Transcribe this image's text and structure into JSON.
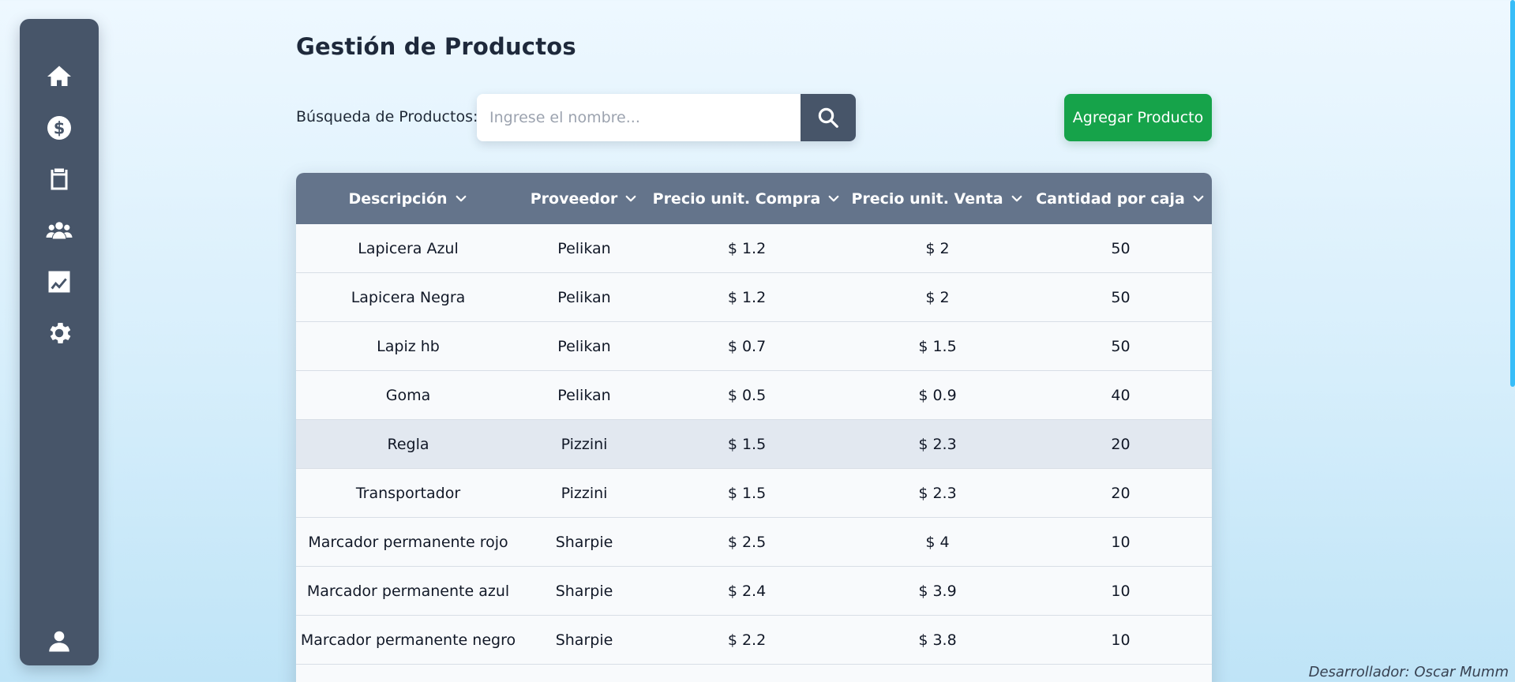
{
  "sidebar": {
    "items": [
      {
        "icon": "home-icon"
      },
      {
        "icon": "dollar-icon"
      },
      {
        "icon": "clipboard-icon"
      },
      {
        "icon": "users-icon"
      },
      {
        "icon": "chart-icon"
      },
      {
        "icon": "gear-icon"
      }
    ],
    "bottom_icon": "user-icon"
  },
  "page": {
    "title": "Gestión de Productos"
  },
  "search": {
    "label": "Búsqueda de Productos:",
    "placeholder": "Ingrese el nombre...",
    "value": ""
  },
  "actions": {
    "add_label": "Agregar Producto"
  },
  "table": {
    "headers": [
      "Descripción",
      "Proveedor",
      "Precio unit. Compra",
      "Precio unit. Venta",
      "Cantidad por caja"
    ],
    "rows": [
      [
        "Lapicera Azul",
        "Pelikan",
        "$ 1.2",
        "$ 2",
        "50"
      ],
      [
        "Lapicera Negra",
        "Pelikan",
        "$ 1.2",
        "$ 2",
        "50"
      ],
      [
        "Lapiz hb",
        "Pelikan",
        "$ 0.7",
        "$ 1.5",
        "50"
      ],
      [
        "Goma",
        "Pelikan",
        "$ 0.5",
        "$ 0.9",
        "40"
      ],
      [
        "Regla",
        "Pizzini",
        "$ 1.5",
        "$ 2.3",
        "20"
      ],
      [
        "Transportador",
        "Pizzini",
        "$ 1.5",
        "$ 2.3",
        "20"
      ],
      [
        "Marcador permanente rojo",
        "Sharpie",
        "$ 2.5",
        "$ 4",
        "10"
      ],
      [
        "Marcador permanente azul",
        "Sharpie",
        "$ 2.4",
        "$ 3.9",
        "10"
      ],
      [
        "Marcador permanente negro",
        "Sharpie",
        "$ 2.2",
        "$ 3.8",
        "10"
      ]
    ],
    "highlighted_row": 4
  },
  "footer": {
    "credit": "Desarrollador: Oscar Mumm"
  },
  "colors": {
    "sidebar": "#475569",
    "table_header": "#64748b",
    "add_button": "#16a34a",
    "row_highlight": "#e2e8f0"
  }
}
